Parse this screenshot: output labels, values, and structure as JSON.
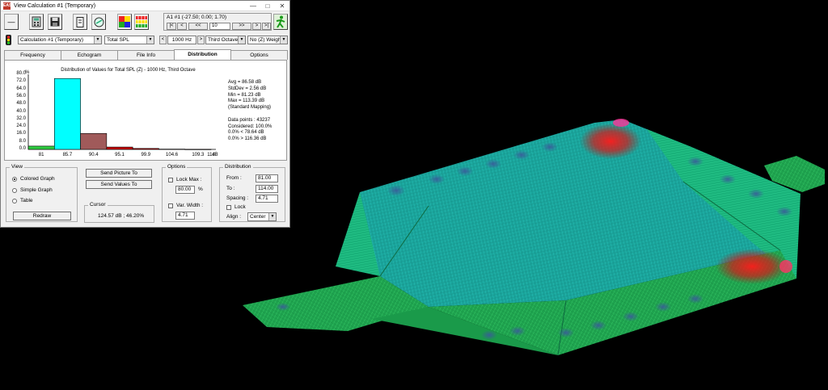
{
  "window": {
    "title": "View Calculation #1 (Temporary)",
    "app_icon": "EASE",
    "controls": [
      "—",
      "□",
      "✕"
    ]
  },
  "toolbar": {
    "position": {
      "coords": "A1 #1   (-27.50; 0.00; 1.70)",
      "first": "|<",
      "prev": "<",
      "prev_fast": "<<",
      "step": "10",
      "next_fast": ">>",
      "next": ">",
      "last": ">|"
    }
  },
  "selectors": {
    "calculation": "Calculation #1 (Temporary)",
    "measure": "Total SPL",
    "frequency": "1000 Hz",
    "band": "Third Octave",
    "weighting": "No (Z) Weigh"
  },
  "tabs": [
    "Frequency",
    "Echogram",
    "File Info",
    "Distribution",
    "Options"
  ],
  "active_tab": "Distribution",
  "chart_data": {
    "type": "bar",
    "title": "Distribution of Values for Total SPL (Z) - 1000 Hz, Third Octave",
    "ylabel": "%",
    "xlabel": "dB",
    "ylim": [
      0,
      80
    ],
    "yticks": [
      "80.0",
      "72.0",
      "64.0",
      "56.0",
      "48.0",
      "40.0",
      "32.0",
      "24.0",
      "16.0",
      "8.0",
      "0.0"
    ],
    "categories": [
      "81",
      "85.7",
      "90.4",
      "95.1",
      "99.9",
      "104.6",
      "109.3",
      "114"
    ],
    "values": [
      3.5,
      75.5,
      17.0,
      2.5,
      1.0,
      0.3,
      0.1
    ],
    "colors": [
      "#2ecc40",
      "#00ffff",
      "#a05a5a",
      "#cc0000",
      "#cc0000",
      "#cc0000",
      "#cc0000"
    ]
  },
  "stats": [
    "Avg = 86.58 dB",
    "StdDev = 2.56 dB",
    "Min = 81.23 dB",
    "Max = 113.39 dB",
    "(Standard Mapping)",
    "",
    "Data points : 43237",
    "Considered: 100.0%",
    "0.0% < 78.64 dB",
    "0.0% > 116.36 dB"
  ],
  "view": {
    "legend": "View",
    "options": [
      "Colored Graph",
      "Simple Graph",
      "Table"
    ],
    "selected": 0,
    "redraw": "Redraw"
  },
  "buttons": {
    "send_picture": "Send Picture To",
    "send_values": "Send Values To"
  },
  "cursor": {
    "legend": "Cursor",
    "value": "124.57 dB ; 46.20%"
  },
  "options": {
    "legend": "Options",
    "lock_max_label": "Lock Max :",
    "lock_max_value": "80.00",
    "lock_max_unit": "%",
    "var_width_label": "Var. Width :",
    "var_width_value": "4.71"
  },
  "distribution": {
    "legend": "Distribution",
    "from_label": "From :",
    "from_value": "81.00",
    "to_label": "To :",
    "to_value": "114.00",
    "spacing_label": "Spacing :",
    "spacing_value": "4.71",
    "lock_label": "Lock",
    "align_label": "Align :",
    "align_value": "Center"
  }
}
